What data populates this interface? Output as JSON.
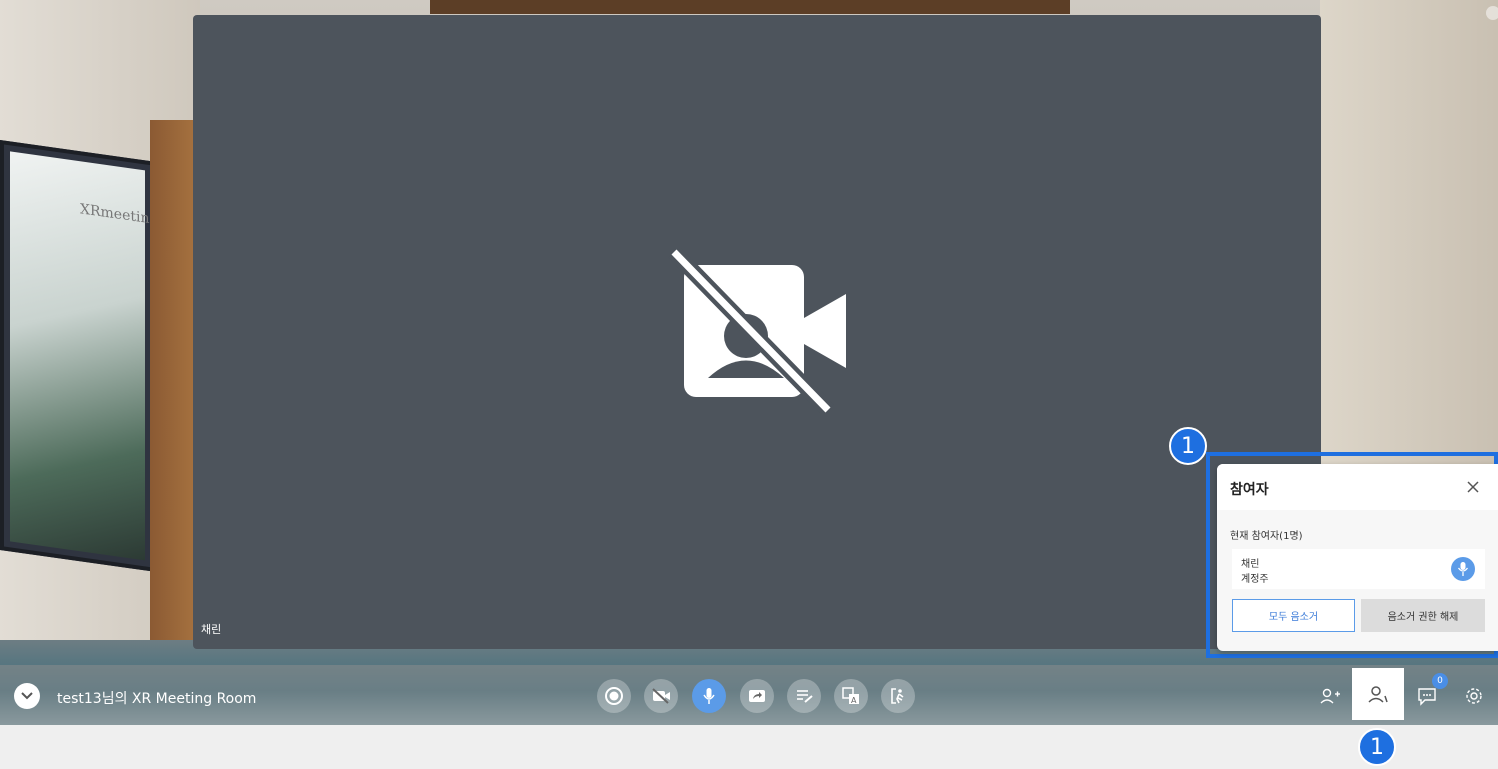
{
  "room": {
    "title": "test13님의 XR Meeting Room",
    "tv_text": "XRmeeting"
  },
  "video": {
    "participant_name": "채린"
  },
  "controls": [
    {
      "name": "record-button",
      "icon": "record-icon"
    },
    {
      "name": "camera-toggle-button",
      "icon": "camera-off-icon"
    },
    {
      "name": "mic-toggle-button",
      "icon": "microphone-icon"
    },
    {
      "name": "screen-share-button",
      "icon": "share-screen-icon"
    },
    {
      "name": "notes-button",
      "icon": "notes-edit-icon"
    },
    {
      "name": "translate-button",
      "icon": "translate-icon"
    },
    {
      "name": "exit-button",
      "icon": "exit-icon"
    }
  ],
  "right_toolbar": {
    "chat_badge": "0"
  },
  "participants_panel": {
    "title": "참여자",
    "count_label": "현재 참여자(1명)",
    "participant": {
      "name": "채린",
      "account": "계정주"
    },
    "mute_all_label": "모두 음소거",
    "release_mute_label": "음소거 권한 해제"
  },
  "callouts": [
    "1",
    "1"
  ],
  "colors": {
    "accent": "#5b9be8",
    "highlight": "#1e6fe0",
    "video_bg": "#4d545c"
  }
}
